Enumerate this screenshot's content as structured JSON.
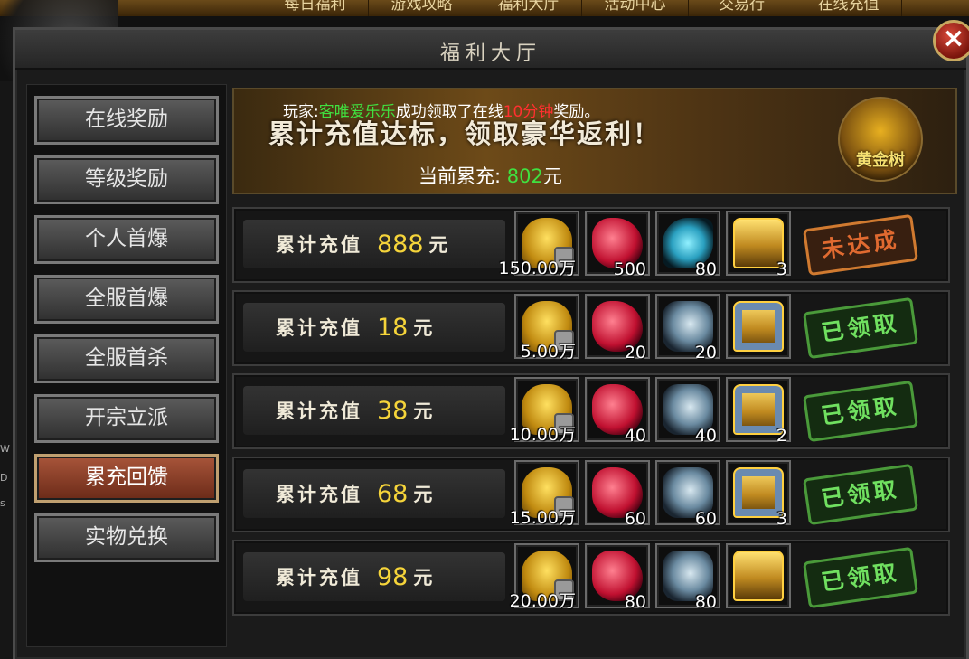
{
  "topnav": [
    "每日福利",
    "游戏攻略",
    "福利大厅",
    "活动中心",
    "交易行",
    "在线充值"
  ],
  "window": {
    "title": "福利大厅",
    "close_label": "×"
  },
  "sidebar": {
    "items": [
      {
        "label": "在线奖励"
      },
      {
        "label": "等级奖励"
      },
      {
        "label": "个人首爆"
      },
      {
        "label": "全服首爆"
      },
      {
        "label": "全服首杀"
      },
      {
        "label": "开宗立派"
      },
      {
        "label": "累充回馈",
        "active": true
      },
      {
        "label": "实物兑换"
      }
    ]
  },
  "edge_letters": [
    "W",
    "D",
    "s"
  ],
  "banner": {
    "headline": "累计充值达标，领取豪华返利！",
    "notice_prefix": "玩家:",
    "notice_player": "客唯爱乐乐",
    "notice_mid": "成功领取了在线",
    "notice_time": "10分钟",
    "notice_suffix": "奖励。",
    "cumul_label": "当前累充:",
    "cumul_value": "802",
    "cumul_unit": "元",
    "tree_label": "黄金树"
  },
  "rewards": [
    {
      "label": "累计充值",
      "amount": "888",
      "unit": "元",
      "items": [
        {
          "icon": "gold-ingot-locked",
          "count": "150.00万"
        },
        {
          "icon": "red-gem",
          "count": "500"
        },
        {
          "icon": "blue-feather",
          "count": "80"
        },
        {
          "icon": "gold-chest",
          "count": "3"
        }
      ],
      "status": "未达成",
      "claimed": false
    },
    {
      "label": "累计充值",
      "amount": "18",
      "unit": "元",
      "items": [
        {
          "icon": "gold-ingot-locked",
          "count": "5.00万"
        },
        {
          "icon": "red-gem",
          "count": "20"
        },
        {
          "icon": "silver-shard",
          "count": "20"
        },
        {
          "icon": "silver-chest",
          "count": ""
        }
      ],
      "status": "已领取",
      "claimed": true
    },
    {
      "label": "累计充值",
      "amount": "38",
      "unit": "元",
      "items": [
        {
          "icon": "gold-ingot-locked",
          "count": "10.00万"
        },
        {
          "icon": "red-gem",
          "count": "40"
        },
        {
          "icon": "silver-shard",
          "count": "40"
        },
        {
          "icon": "silver-chest",
          "count": "2"
        }
      ],
      "status": "已领取",
      "claimed": true
    },
    {
      "label": "累计充值",
      "amount": "68",
      "unit": "元",
      "items": [
        {
          "icon": "gold-ingot-locked",
          "count": "15.00万"
        },
        {
          "icon": "red-gem",
          "count": "60"
        },
        {
          "icon": "silver-shard",
          "count": "60"
        },
        {
          "icon": "silver-chest",
          "count": "3"
        }
      ],
      "status": "已领取",
      "claimed": true
    },
    {
      "label": "累计充值",
      "amount": "98",
      "unit": "元",
      "items": [
        {
          "icon": "gold-ingot-locked",
          "count": "20.00万"
        },
        {
          "icon": "red-gem",
          "count": "80"
        },
        {
          "icon": "silver-shard",
          "count": "80"
        },
        {
          "icon": "open-chest",
          "count": ""
        }
      ],
      "status": "已领取",
      "claimed": true
    }
  ]
}
